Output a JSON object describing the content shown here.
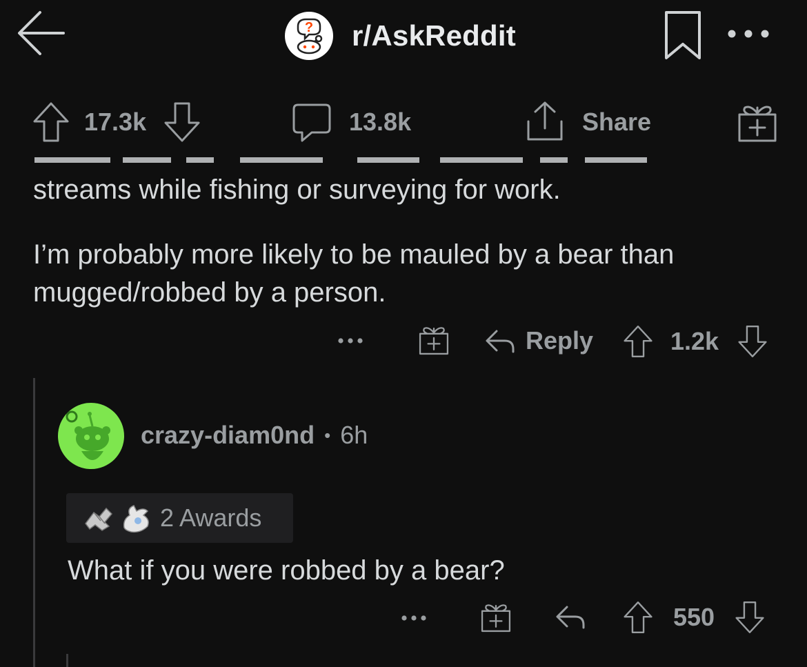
{
  "header": {
    "subreddit": "r/AskReddit"
  },
  "post_actions": {
    "upvotes": "17.3k",
    "comments": "13.8k",
    "share_label": "Share"
  },
  "parent_comment": {
    "text_line1": "streams while fishing or surveying for work.",
    "paragraph2": "I’m probably more likely to be mauled by a bear than mugged/robbed by a person.",
    "reply_label": "Reply",
    "score": "1.2k"
  },
  "reply_comment": {
    "username": "crazy-diam0nd",
    "separator": "•",
    "age": "6h",
    "awards_label": "2 Awards",
    "text": "What if you were robbed by a bear?",
    "score": "550"
  },
  "colors": {
    "background": "#0f0f0f",
    "text": "#d7dadc",
    "muted": "#9a9ea1",
    "avatar_green": "#7ee64e",
    "icon_orange": "#ff4500"
  },
  "icons": [
    "back-arrow-icon",
    "subreddit-icon",
    "bookmark-icon",
    "more-icon",
    "upvote-icon",
    "downvote-icon",
    "comment-icon",
    "share-icon",
    "gift-icon",
    "reply-icon",
    "avatar-snoo",
    "award-icon"
  ]
}
